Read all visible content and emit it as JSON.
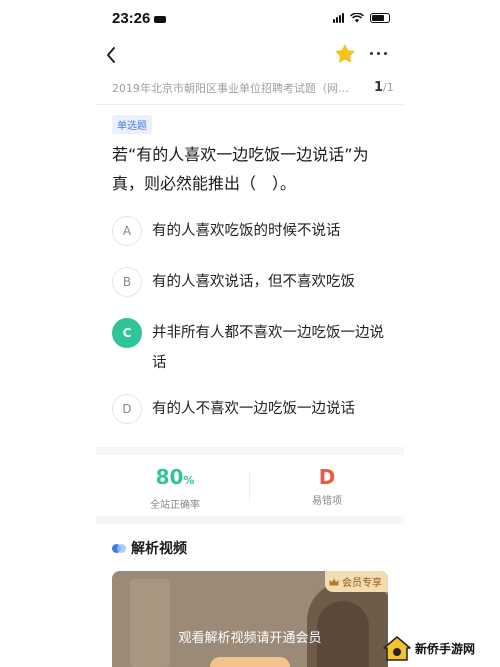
{
  "status_bar": {
    "time": "23:26"
  },
  "source": {
    "title": "2019年北京市朝阳区事业单位招聘考试题（网友回...",
    "current_page": "1",
    "total_pages": "/1"
  },
  "question": {
    "type": "单选题",
    "stem": "若“有的人喜欢一边吃饭一边说话”为真，则必然能推出（　）。",
    "options": [
      {
        "letter": "A",
        "text": "有的人喜欢吃饭的时候不说话",
        "selected": false
      },
      {
        "letter": "B",
        "text": "有的人喜欢说话，但不喜欢吃饭",
        "selected": false
      },
      {
        "letter": "C",
        "text": "并非所有人都不喜欢一边吃饭一边说话",
        "selected": true
      },
      {
        "letter": "D",
        "text": "有的人不喜欢一边吃饭一边说话",
        "selected": false
      }
    ]
  },
  "stats": {
    "accuracy_value": "80",
    "accuracy_unit": "%",
    "accuracy_label": "全站正确率",
    "wrong_option_value": "D",
    "wrong_option_label": "易错项"
  },
  "analysis": {
    "section_title": "解析视频",
    "vip_badge": "会员专享",
    "prompt": "观看解析视频请开通会员"
  },
  "watermark": {
    "text": "新侨手游网"
  },
  "colors": {
    "accent_green": "#2fc49a",
    "accent_blue": "#3d79e8",
    "accuracy_color": "#2fc49a",
    "wrong_color": "#ef5a3c",
    "star_color": "#f7c21c"
  }
}
